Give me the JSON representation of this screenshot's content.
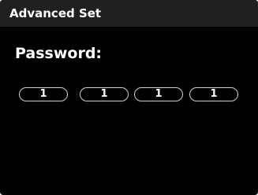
{
  "title_bar": {
    "title": "Advanced Set"
  },
  "password": {
    "label": "Password:",
    "digits": [
      "1",
      "1",
      "1",
      "1"
    ]
  },
  "colors": {
    "background": "#000000",
    "title_bar": "#202020",
    "text": "#ffffff",
    "field_border": "#cfcfcf"
  }
}
